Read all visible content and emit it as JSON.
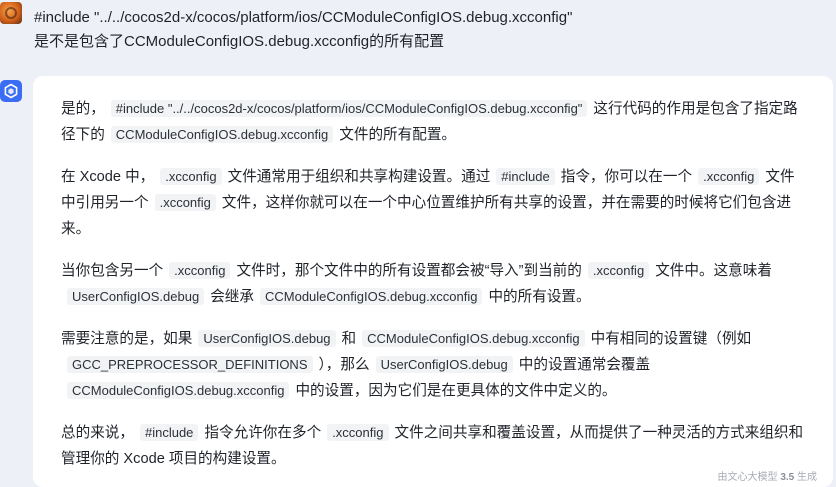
{
  "user": {
    "line1": "#include \"../../cocos2d-x/cocos/platform/ios/CCModuleConfigIOS.debug.xcconfig\"",
    "line2": "是不是包含了CCModuleConfigIOS.debug.xcconfig的所有配置"
  },
  "answer": {
    "p1": {
      "t1": "是的，",
      "c1": "#include \"../../cocos2d-x/cocos/platform/ios/CCModuleConfigIOS.debug.xcconfig\"",
      "t2": "这行代码的作用是包含了指定路径下的",
      "c2": "CCModuleConfigIOS.debug.xcconfig",
      "t3": "文件的所有配置。"
    },
    "p2": {
      "t1": "在 Xcode 中，",
      "c1": ".xcconfig",
      "t2": "文件通常用于组织和共享构建设置。通过",
      "c2": "#include",
      "t3": "指令，你可以在一个",
      "c3": ".xcconfig",
      "t4": "文件中引用另一个",
      "c4": ".xcconfig",
      "t5": "文件，这样你就可以在一个中心位置维护所有共享的设置，并在需要的时候将它们包含进来。"
    },
    "p3": {
      "t1": "当你包含另一个",
      "c1": ".xcconfig",
      "t2": "文件时，那个文件中的所有设置都会被“导入”到当前的",
      "c2": ".xcconfig",
      "t3": "文件中。这意味着",
      "c3": "UserConfigIOS.debug",
      "t4": "会继承",
      "c4": "CCModuleConfigIOS.debug.xcconfig",
      "t5": "中的所有设置。"
    },
    "p4": {
      "t1": "需要注意的是，如果",
      "c1": "UserConfigIOS.debug",
      "t2": "和",
      "c2": "CCModuleConfigIOS.debug.xcconfig",
      "t3": "中有相同的设置键（例如",
      "c3": "GCC_PREPROCESSOR_DEFINITIONS",
      "t4": "），那么",
      "c4": "UserConfigIOS.debug",
      "t5": "中的设置通常会覆盖",
      "c5": "CCModuleConfigIOS.debug.xcconfig",
      "t6": "中的设置，因为它们是在更具体的文件中定义的。"
    },
    "p5": {
      "t1": "总的来说，",
      "c1": "#include",
      "t2": "指令允许你在多个",
      "c2": ".xcconfig",
      "t3": "文件之间共享和覆盖设置，从而提供了一种灵活的方式来组织和管理你的 Xcode 项目的构建设置。"
    }
  },
  "footer": {
    "prefix": "由文心大模型",
    "version": "3.5",
    "suffix": "生成"
  },
  "icons": {
    "user_avatar": "basketball-avatar-icon",
    "bot_avatar": "ernie-bot-icon"
  },
  "colors": {
    "background": "#eef0f7",
    "card": "#ffffff",
    "bot_accent": "#3b6cf4",
    "code_bg": "#f2f3f5"
  }
}
